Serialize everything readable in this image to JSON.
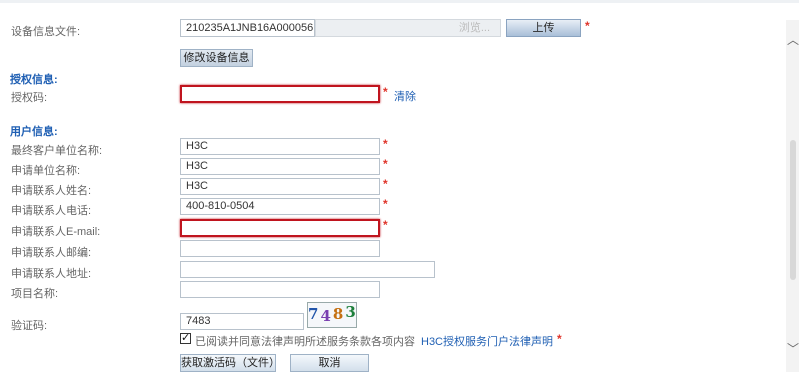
{
  "device_info": {
    "label": "设备信息文件:",
    "file_value": "210235A1JNB16A000056",
    "browse_label": "浏览...",
    "upload_label": "上传",
    "modify_label": "修改设备信息"
  },
  "auth": {
    "section_title": "授权信息:",
    "code_label": "授权码:",
    "code_value": "",
    "clear_label": "清除"
  },
  "user": {
    "section_title": "用户信息:",
    "fields": [
      {
        "label": "最终客户单位名称:",
        "value": "H3C",
        "required": true
      },
      {
        "label": "申请单位名称:",
        "value": "H3C",
        "required": true
      },
      {
        "label": "申请联系人姓名:",
        "value": "H3C",
        "required": true
      },
      {
        "label": "申请联系人电话:",
        "value": "400-810-0504",
        "required": true
      },
      {
        "label": "申请联系人E-mail:",
        "value": "",
        "required": true
      },
      {
        "label": "申请联系人邮编:",
        "value": "",
        "required": false
      },
      {
        "label": "申请联系人地址:",
        "value": "",
        "required": false
      },
      {
        "label": "项目名称:",
        "value": "",
        "required": false
      }
    ]
  },
  "captcha": {
    "label": "验证码:",
    "value": "7483",
    "image_chars": [
      "7",
      "4",
      "8",
      "3"
    ]
  },
  "agreement": {
    "checked": true,
    "text": "已阅读并同意法律声明所述服务条款各项内容",
    "link": "H3C授权服务门户法律声明"
  },
  "actions": {
    "get_code_label": "获取激活码（文件）",
    "cancel_label": "取消"
  },
  "required_mark": "*",
  "scrollbar": {
    "up_glyph": "︿",
    "down_glyph": "﹀"
  }
}
